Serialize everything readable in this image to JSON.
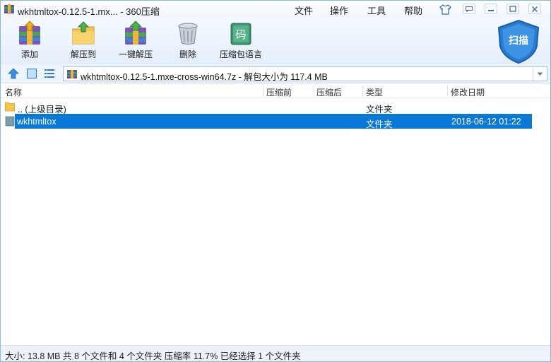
{
  "titlebar": {
    "title": "wkhtmltox-0.12.5-1.mx... - 360压缩",
    "menus": [
      "文件",
      "操作",
      "工具",
      "帮助"
    ]
  },
  "toolbar": {
    "items": [
      {
        "label": "添加",
        "icon": "add-archive-icon"
      },
      {
        "label": "解压到",
        "icon": "extract-to-icon"
      },
      {
        "label": "一键解压",
        "icon": "one-click-extract-icon"
      },
      {
        "label": "删除",
        "icon": "trash-icon"
      },
      {
        "label": "压缩包语言",
        "icon": "encoding-icon"
      }
    ],
    "encoding_glyph": "码",
    "scan_label": "扫描"
  },
  "address": {
    "path": "wkhtmltox-0.12.5-1.mxe-cross-win64.7z - 解包大小为 117.4 MB"
  },
  "columns": [
    "名称",
    "压缩前",
    "压缩后",
    "类型",
    "修改日期"
  ],
  "rows": [
    {
      "name": ".. (上级目录)",
      "before": "",
      "after": "",
      "type": "文件夹",
      "modified": "",
      "selected": false
    },
    {
      "name": "wkhtmltox",
      "before": "",
      "after": "",
      "type": "文件夹",
      "modified": "2018-06-12 01:22",
      "selected": true
    }
  ],
  "status": {
    "text": "大小: 13.8 MB 共 8 个文件和 4 个文件夹 压缩率 11.7% 已经选择 1 个文件夹"
  },
  "colors": {
    "selection": "#0a78d7",
    "folder": "#f5c84c",
    "accent": "#2b7bd1"
  }
}
